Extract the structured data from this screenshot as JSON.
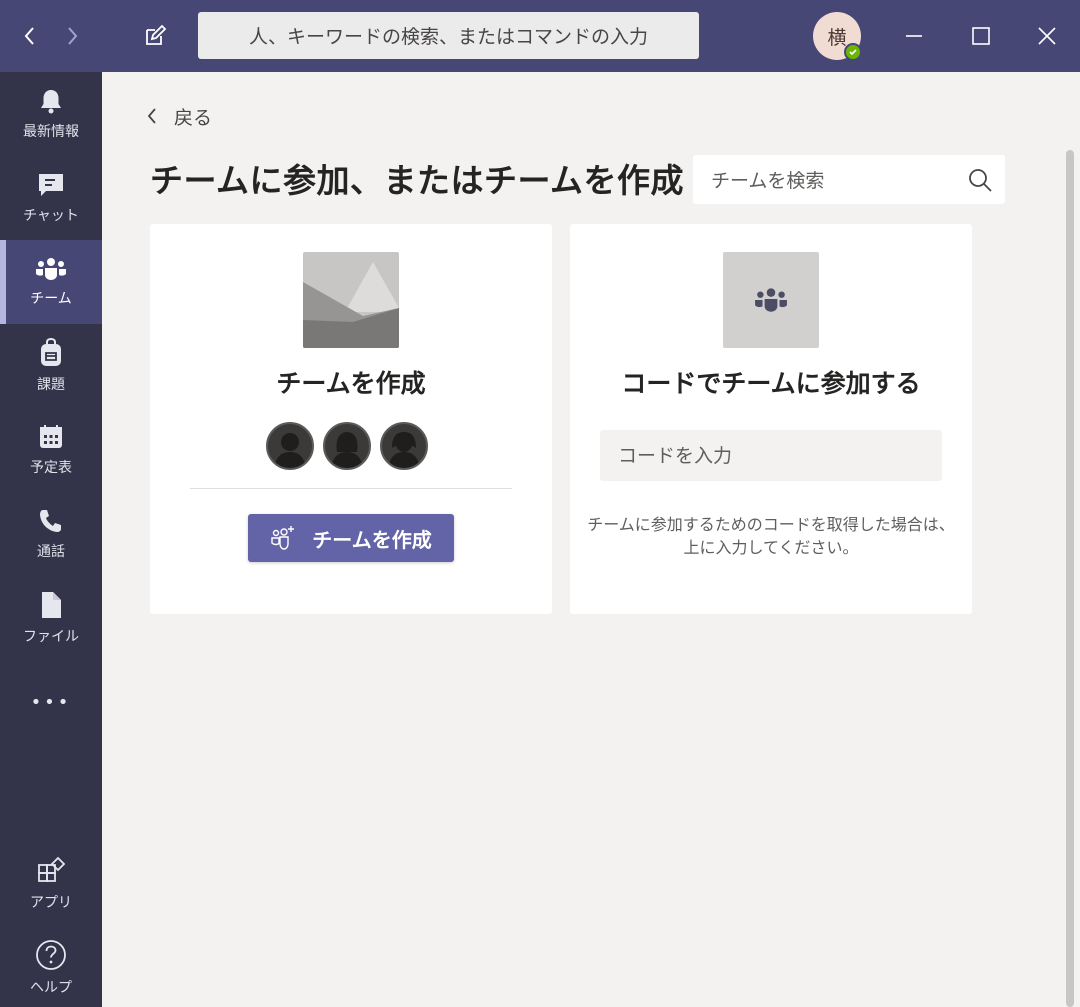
{
  "titlebar": {
    "search_placeholder": "人、キーワードの検索、またはコマンドの入力",
    "avatar_initial": "横"
  },
  "rail": {
    "items": [
      {
        "label": "最新情報",
        "icon": "bell-icon"
      },
      {
        "label": "チャット",
        "icon": "chat-icon"
      },
      {
        "label": "チーム",
        "icon": "teams-icon",
        "active": true
      },
      {
        "label": "課題",
        "icon": "backpack-icon"
      },
      {
        "label": "予定表",
        "icon": "calendar-icon"
      },
      {
        "label": "通話",
        "icon": "phone-icon"
      },
      {
        "label": "ファイル",
        "icon": "file-icon"
      }
    ],
    "more_label": "•••",
    "apps_label": "アプリ",
    "help_label": "ヘルプ"
  },
  "main": {
    "back_label": "戻る",
    "page_title": "チームに参加、またはチームを作成",
    "search_placeholder": "チームを検索",
    "create_card": {
      "title": "チームを作成",
      "button_label": "チームを作成"
    },
    "join_card": {
      "title": "コードでチームに参加する",
      "code_placeholder": "コードを入力",
      "help_line1": "チームに参加するためのコードを取得した場合は、",
      "help_line2": "上に入力してください。"
    }
  },
  "colors": {
    "titlebar": "#464775",
    "rail": "#33344a",
    "accent": "#6264a7",
    "presence": "#6bb700"
  }
}
